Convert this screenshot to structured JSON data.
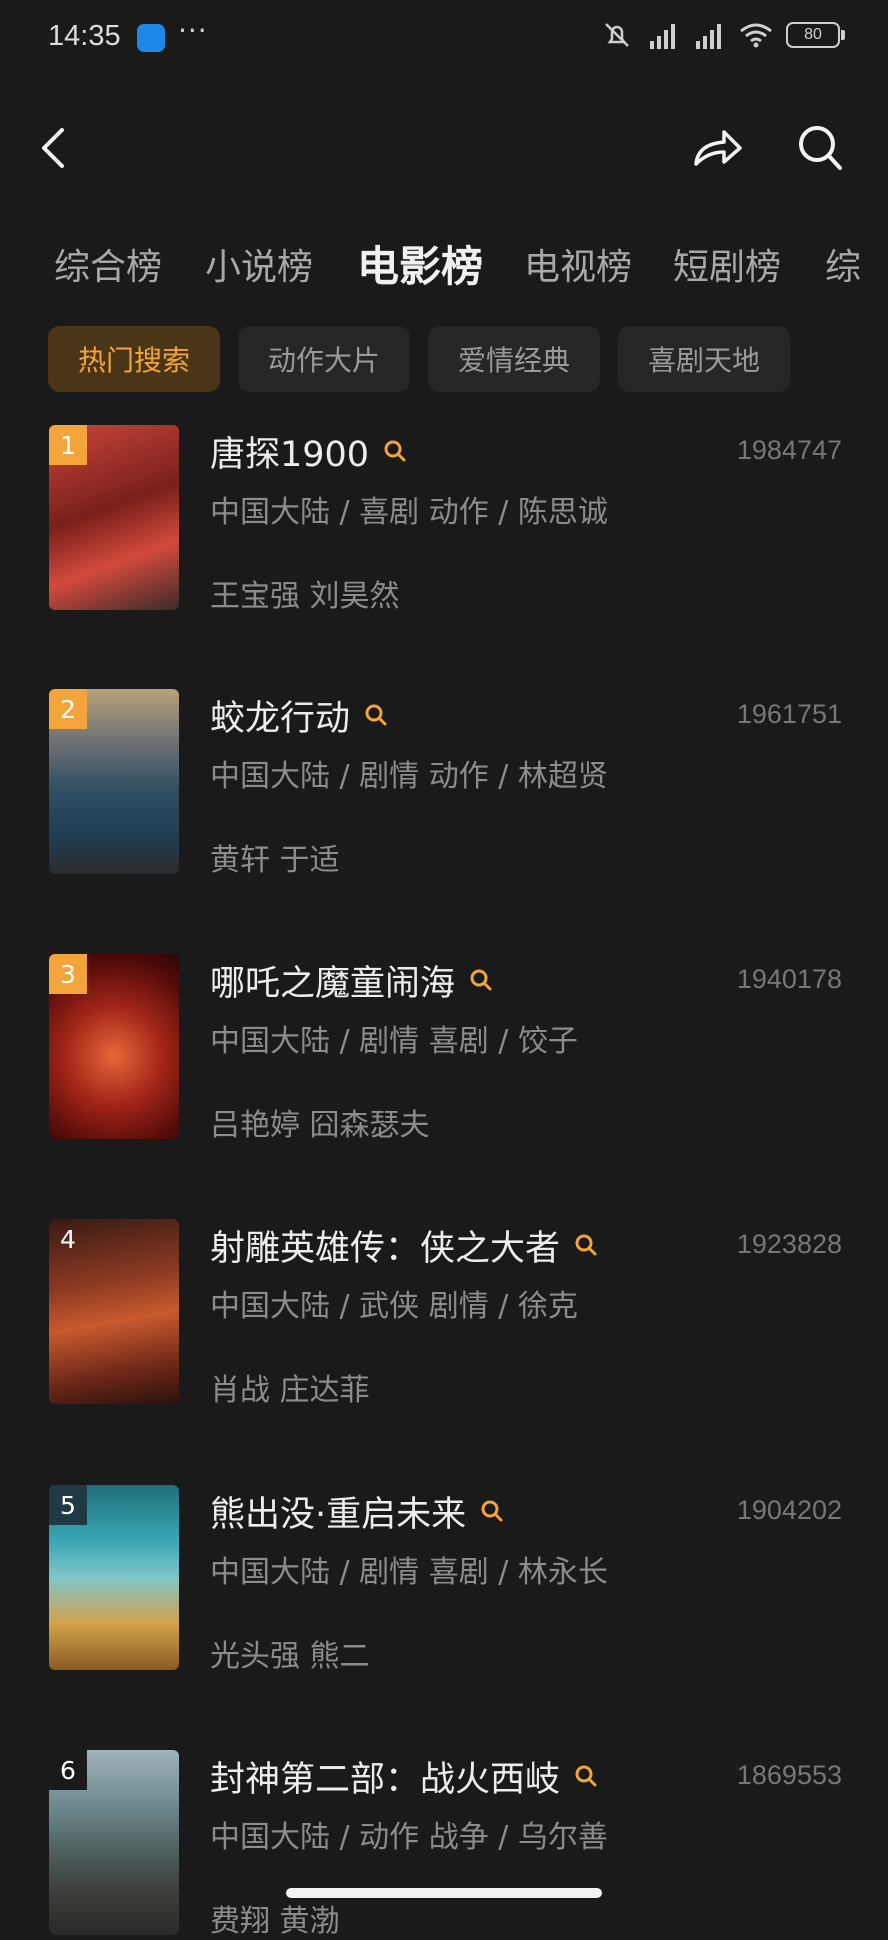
{
  "status_bar": {
    "time": "14:35",
    "dots": "···",
    "battery": "80"
  },
  "tabs": [
    {
      "label": "综合榜"
    },
    {
      "label": "小说榜"
    },
    {
      "label": "电影榜"
    },
    {
      "label": "电视榜"
    },
    {
      "label": "短剧榜"
    },
    {
      "label": "综"
    }
  ],
  "active_tab": "电影榜",
  "chips": [
    {
      "label": "热门搜索"
    },
    {
      "label": "动作大片"
    },
    {
      "label": "爱情经典"
    },
    {
      "label": "喜剧天地"
    }
  ],
  "active_chip": "热门搜索",
  "items": [
    {
      "rank": "1",
      "title": "唐探1900",
      "hot": "1984747",
      "meta": "中国大陆 / 喜剧 动作 / 陈思诚",
      "cast": "王宝强 刘昊然"
    },
    {
      "rank": "2",
      "title": "蛟龙行动",
      "hot": "1961751",
      "meta": "中国大陆 / 剧情 动作 / 林超贤",
      "cast": "黄轩 于适"
    },
    {
      "rank": "3",
      "title": "哪吒之魔童闹海",
      "hot": "1940178",
      "meta": "中国大陆 / 剧情 喜剧 / 饺子",
      "cast": "吕艳婷 囧森瑟夫"
    },
    {
      "rank": "4",
      "title": "射雕英雄传：侠之大者",
      "hot": "1923828",
      "meta": "中国大陆 / 武侠 剧情 / 徐克",
      "cast": "肖战 庄达菲"
    },
    {
      "rank": "5",
      "title": "熊出没·重启未来",
      "hot": "1904202",
      "meta": "中国大陆 / 剧情 喜剧 / 林永长",
      "cast": "光头强 熊二"
    },
    {
      "rank": "6",
      "title": "封神第二部：战火西岐",
      "hot": "1869553",
      "meta": "中国大陆 / 动作 战争 / 乌尔善",
      "cast": "费翔 黄渤"
    }
  ],
  "colors": {
    "accent": "#f3a43a",
    "background": "#1a1a1a"
  }
}
